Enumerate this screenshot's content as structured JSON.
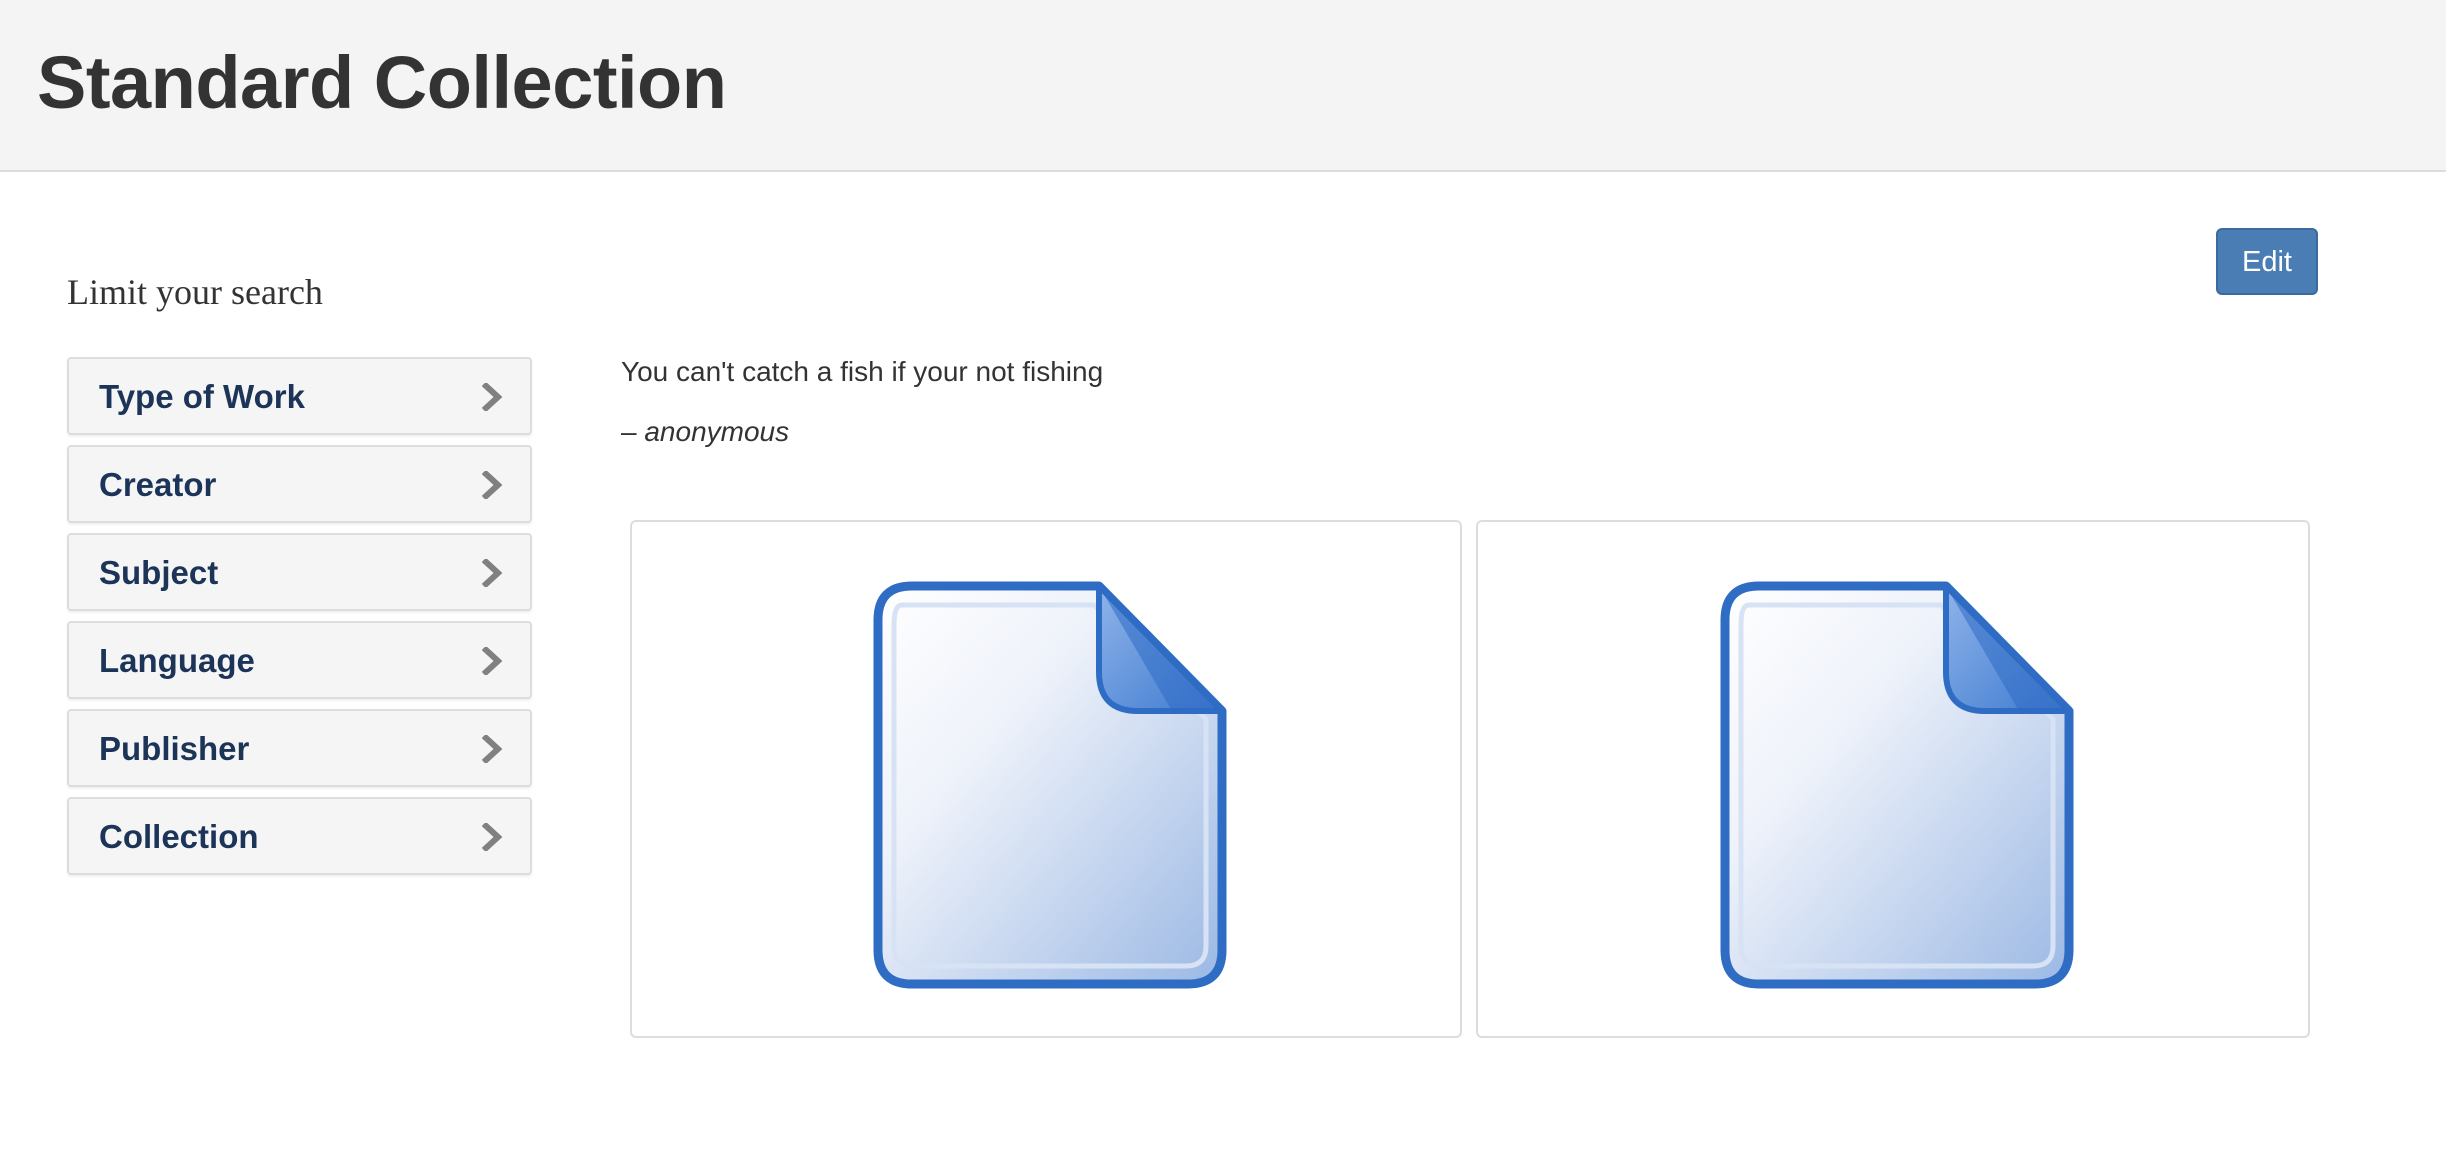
{
  "header": {
    "title": "Standard Collection"
  },
  "actions": {
    "edit_label": "Edit"
  },
  "sidebar": {
    "heading": "Limit your search",
    "facets": [
      {
        "label": "Type of Work",
        "icon": "chevron-right-icon"
      },
      {
        "label": "Creator",
        "icon": "chevron-right-icon"
      },
      {
        "label": "Subject",
        "icon": "chevron-right-icon"
      },
      {
        "label": "Language",
        "icon": "chevron-right-icon"
      },
      {
        "label": "Publisher",
        "icon": "chevron-right-icon"
      },
      {
        "label": "Collection",
        "icon": "chevron-right-icon"
      }
    ]
  },
  "main": {
    "quote": {
      "text": "You can't catch a fish if your not fishing",
      "dash": "– ",
      "author": "anonymous"
    },
    "items": [
      {
        "icon": "generic-file-icon"
      },
      {
        "icon": "generic-file-icon"
      }
    ]
  },
  "colors": {
    "header_bg": "#f4f4f4",
    "button_bg": "#4a7db4",
    "facet_text": "#1c3458",
    "file_icon_blue": "#2f6cc4"
  }
}
